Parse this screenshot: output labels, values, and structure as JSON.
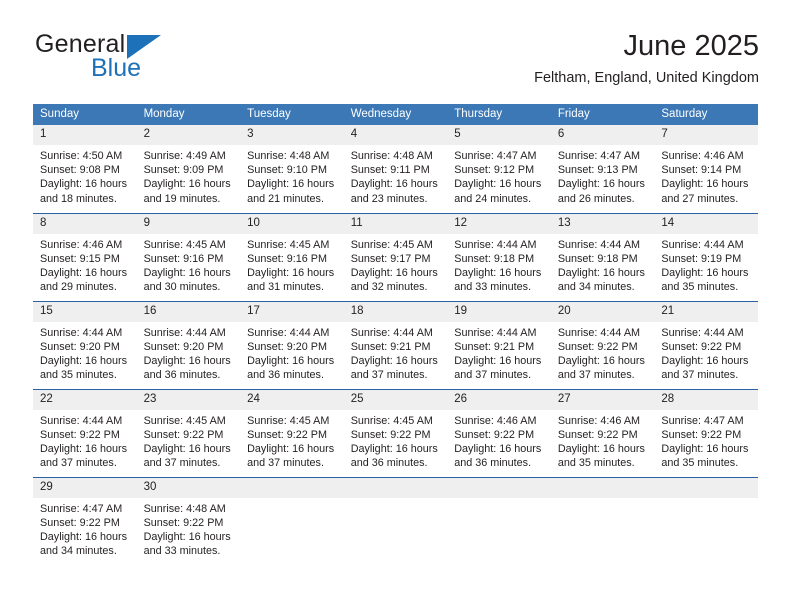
{
  "brand": {
    "name_line1": "General",
    "name_line2": "Blue",
    "logo_icon": "blue-flag-triangle-icon"
  },
  "header": {
    "month_title": "June 2025",
    "location": "Feltham, England, United Kingdom"
  },
  "colors": {
    "header_blue": "#3b78b5",
    "row_rule_blue": "#2a63a4",
    "daynum_band": "#efefef",
    "brand_blue": "#1d71b8",
    "text": "#231f20"
  },
  "calendar": {
    "weekday_headers": [
      "Sunday",
      "Monday",
      "Tuesday",
      "Wednesday",
      "Thursday",
      "Friday",
      "Saturday"
    ],
    "weeks": [
      [
        {
          "day": "1",
          "sunrise": "Sunrise: 4:50 AM",
          "sunset": "Sunset: 9:08 PM",
          "daylight_line1": "Daylight: 16 hours",
          "daylight_line2": "and 18 minutes."
        },
        {
          "day": "2",
          "sunrise": "Sunrise: 4:49 AM",
          "sunset": "Sunset: 9:09 PM",
          "daylight_line1": "Daylight: 16 hours",
          "daylight_line2": "and 19 minutes."
        },
        {
          "day": "3",
          "sunrise": "Sunrise: 4:48 AM",
          "sunset": "Sunset: 9:10 PM",
          "daylight_line1": "Daylight: 16 hours",
          "daylight_line2": "and 21 minutes."
        },
        {
          "day": "4",
          "sunrise": "Sunrise: 4:48 AM",
          "sunset": "Sunset: 9:11 PM",
          "daylight_line1": "Daylight: 16 hours",
          "daylight_line2": "and 23 minutes."
        },
        {
          "day": "5",
          "sunrise": "Sunrise: 4:47 AM",
          "sunset": "Sunset: 9:12 PM",
          "daylight_line1": "Daylight: 16 hours",
          "daylight_line2": "and 24 minutes."
        },
        {
          "day": "6",
          "sunrise": "Sunrise: 4:47 AM",
          "sunset": "Sunset: 9:13 PM",
          "daylight_line1": "Daylight: 16 hours",
          "daylight_line2": "and 26 minutes."
        },
        {
          "day": "7",
          "sunrise": "Sunrise: 4:46 AM",
          "sunset": "Sunset: 9:14 PM",
          "daylight_line1": "Daylight: 16 hours",
          "daylight_line2": "and 27 minutes."
        }
      ],
      [
        {
          "day": "8",
          "sunrise": "Sunrise: 4:46 AM",
          "sunset": "Sunset: 9:15 PM",
          "daylight_line1": "Daylight: 16 hours",
          "daylight_line2": "and 29 minutes."
        },
        {
          "day": "9",
          "sunrise": "Sunrise: 4:45 AM",
          "sunset": "Sunset: 9:16 PM",
          "daylight_line1": "Daylight: 16 hours",
          "daylight_line2": "and 30 minutes."
        },
        {
          "day": "10",
          "sunrise": "Sunrise: 4:45 AM",
          "sunset": "Sunset: 9:16 PM",
          "daylight_line1": "Daylight: 16 hours",
          "daylight_line2": "and 31 minutes."
        },
        {
          "day": "11",
          "sunrise": "Sunrise: 4:45 AM",
          "sunset": "Sunset: 9:17 PM",
          "daylight_line1": "Daylight: 16 hours",
          "daylight_line2": "and 32 minutes."
        },
        {
          "day": "12",
          "sunrise": "Sunrise: 4:44 AM",
          "sunset": "Sunset: 9:18 PM",
          "daylight_line1": "Daylight: 16 hours",
          "daylight_line2": "and 33 minutes."
        },
        {
          "day": "13",
          "sunrise": "Sunrise: 4:44 AM",
          "sunset": "Sunset: 9:18 PM",
          "daylight_line1": "Daylight: 16 hours",
          "daylight_line2": "and 34 minutes."
        },
        {
          "day": "14",
          "sunrise": "Sunrise: 4:44 AM",
          "sunset": "Sunset: 9:19 PM",
          "daylight_line1": "Daylight: 16 hours",
          "daylight_line2": "and 35 minutes."
        }
      ],
      [
        {
          "day": "15",
          "sunrise": "Sunrise: 4:44 AM",
          "sunset": "Sunset: 9:20 PM",
          "daylight_line1": "Daylight: 16 hours",
          "daylight_line2": "and 35 minutes."
        },
        {
          "day": "16",
          "sunrise": "Sunrise: 4:44 AM",
          "sunset": "Sunset: 9:20 PM",
          "daylight_line1": "Daylight: 16 hours",
          "daylight_line2": "and 36 minutes."
        },
        {
          "day": "17",
          "sunrise": "Sunrise: 4:44 AM",
          "sunset": "Sunset: 9:20 PM",
          "daylight_line1": "Daylight: 16 hours",
          "daylight_line2": "and 36 minutes."
        },
        {
          "day": "18",
          "sunrise": "Sunrise: 4:44 AM",
          "sunset": "Sunset: 9:21 PM",
          "daylight_line1": "Daylight: 16 hours",
          "daylight_line2": "and 37 minutes."
        },
        {
          "day": "19",
          "sunrise": "Sunrise: 4:44 AM",
          "sunset": "Sunset: 9:21 PM",
          "daylight_line1": "Daylight: 16 hours",
          "daylight_line2": "and 37 minutes."
        },
        {
          "day": "20",
          "sunrise": "Sunrise: 4:44 AM",
          "sunset": "Sunset: 9:22 PM",
          "daylight_line1": "Daylight: 16 hours",
          "daylight_line2": "and 37 minutes."
        },
        {
          "day": "21",
          "sunrise": "Sunrise: 4:44 AM",
          "sunset": "Sunset: 9:22 PM",
          "daylight_line1": "Daylight: 16 hours",
          "daylight_line2": "and 37 minutes."
        }
      ],
      [
        {
          "day": "22",
          "sunrise": "Sunrise: 4:44 AM",
          "sunset": "Sunset: 9:22 PM",
          "daylight_line1": "Daylight: 16 hours",
          "daylight_line2": "and 37 minutes."
        },
        {
          "day": "23",
          "sunrise": "Sunrise: 4:45 AM",
          "sunset": "Sunset: 9:22 PM",
          "daylight_line1": "Daylight: 16 hours",
          "daylight_line2": "and 37 minutes."
        },
        {
          "day": "24",
          "sunrise": "Sunrise: 4:45 AM",
          "sunset": "Sunset: 9:22 PM",
          "daylight_line1": "Daylight: 16 hours",
          "daylight_line2": "and 37 minutes."
        },
        {
          "day": "25",
          "sunrise": "Sunrise: 4:45 AM",
          "sunset": "Sunset: 9:22 PM",
          "daylight_line1": "Daylight: 16 hours",
          "daylight_line2": "and 36 minutes."
        },
        {
          "day": "26",
          "sunrise": "Sunrise: 4:46 AM",
          "sunset": "Sunset: 9:22 PM",
          "daylight_line1": "Daylight: 16 hours",
          "daylight_line2": "and 36 minutes."
        },
        {
          "day": "27",
          "sunrise": "Sunrise: 4:46 AM",
          "sunset": "Sunset: 9:22 PM",
          "daylight_line1": "Daylight: 16 hours",
          "daylight_line2": "and 35 minutes."
        },
        {
          "day": "28",
          "sunrise": "Sunrise: 4:47 AM",
          "sunset": "Sunset: 9:22 PM",
          "daylight_line1": "Daylight: 16 hours",
          "daylight_line2": "and 35 minutes."
        }
      ],
      [
        {
          "day": "29",
          "sunrise": "Sunrise: 4:47 AM",
          "sunset": "Sunset: 9:22 PM",
          "daylight_line1": "Daylight: 16 hours",
          "daylight_line2": "and 34 minutes."
        },
        {
          "day": "30",
          "sunrise": "Sunrise: 4:48 AM",
          "sunset": "Sunset: 9:22 PM",
          "daylight_line1": "Daylight: 16 hours",
          "daylight_line2": "and 33 minutes."
        },
        {
          "day": "",
          "sunrise": "",
          "sunset": "",
          "daylight_line1": "",
          "daylight_line2": ""
        },
        {
          "day": "",
          "sunrise": "",
          "sunset": "",
          "daylight_line1": "",
          "daylight_line2": ""
        },
        {
          "day": "",
          "sunrise": "",
          "sunset": "",
          "daylight_line1": "",
          "daylight_line2": ""
        },
        {
          "day": "",
          "sunrise": "",
          "sunset": "",
          "daylight_line1": "",
          "daylight_line2": ""
        },
        {
          "day": "",
          "sunrise": "",
          "sunset": "",
          "daylight_line1": "",
          "daylight_line2": ""
        }
      ]
    ]
  }
}
